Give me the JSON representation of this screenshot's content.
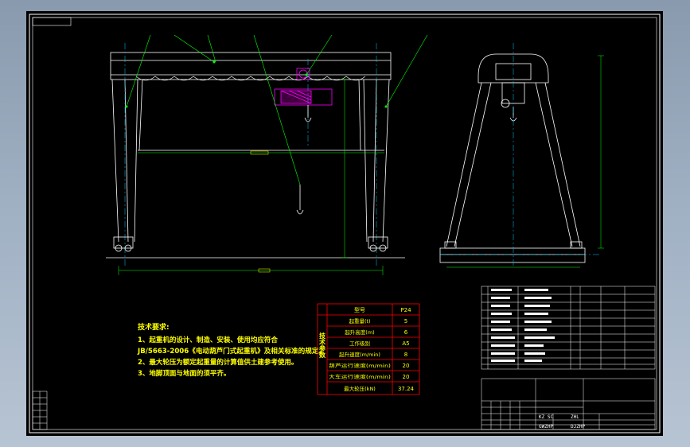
{
  "title_block": {
    "drawing_name": "",
    "code": "",
    "top_label": "",
    "sub_label": "",
    "tags": [
      "KZ SC",
      "ZHL",
      "GWZHP",
      "DJZHP"
    ]
  },
  "notes": {
    "heading": "技术要求:",
    "lines": [
      "1、起重机的设计、制造、安装、使用均应符合",
      "JB/5663-2006《电动葫芦门式起重机》及相关标准的规定。",
      "2、最大轮压为额定起重量的计算值供土建参考使用。",
      "3、地脚顶面与地面的须平齐。"
    ]
  },
  "spec_table": {
    "side_label": "技术参数",
    "header": [
      "型号",
      "P24"
    ],
    "rows": [
      [
        "起重量(t)",
        "5"
      ],
      [
        "起升高度(m)",
        "6"
      ],
      [
        "工作级别",
        "A5"
      ],
      [
        "起升速度(m/min)",
        "8"
      ],
      [
        "葫芦运行速度(m/min)",
        "20"
      ],
      [
        "大车运行速度(m/min)",
        "20"
      ],
      [
        "最大轮压(kN)",
        "37.24"
      ]
    ]
  },
  "colors": {
    "frame": "#ffffff",
    "structure": "#ffffff",
    "leader": "#00ff00",
    "centerline": "#00c8ff",
    "hoist": "#ff00ff",
    "table_border": "#ff0000",
    "text": "#ffff00",
    "dim": "#00ff00"
  }
}
